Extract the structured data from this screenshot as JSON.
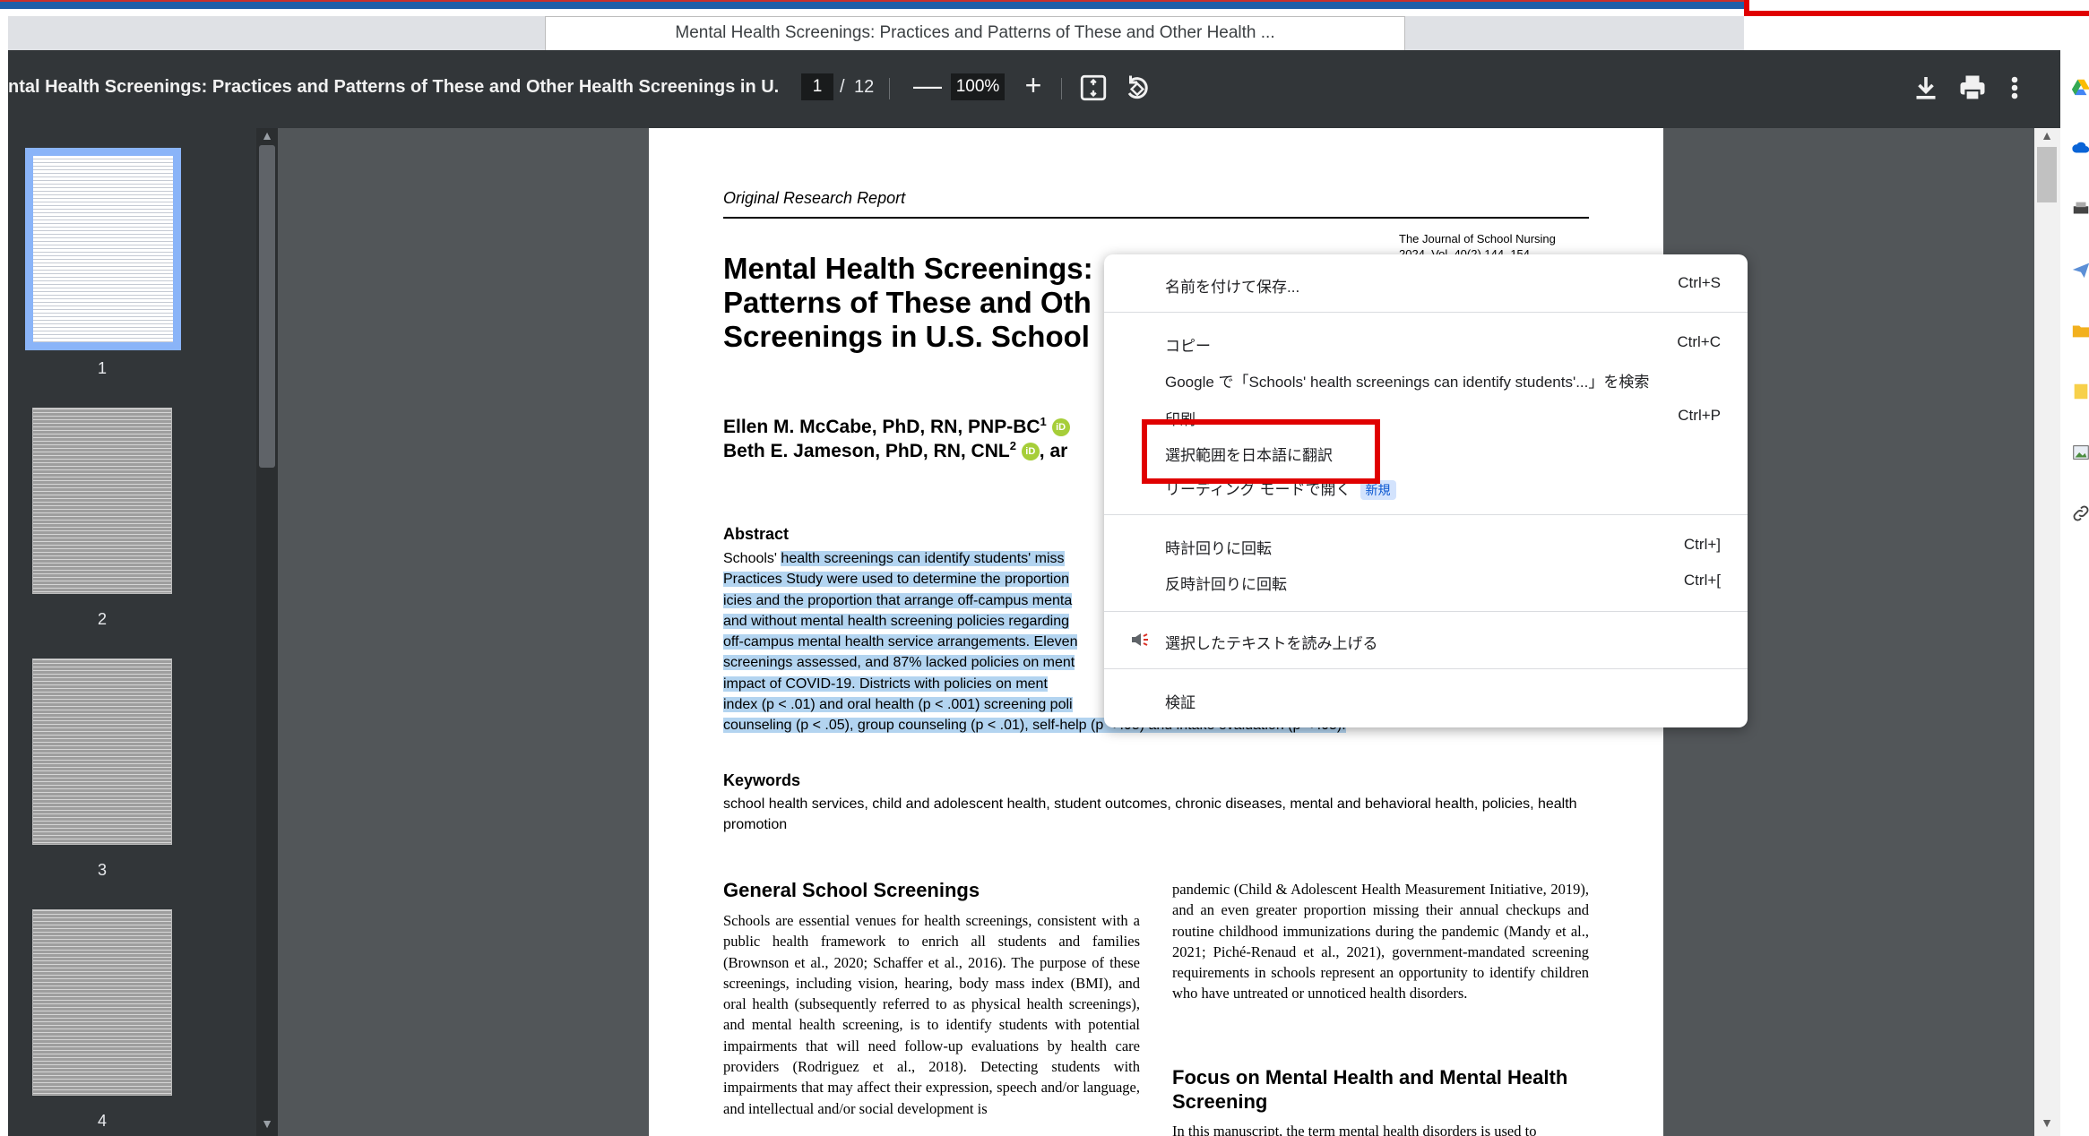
{
  "browser": {
    "tab_title": "Mental Health Screenings: Practices and Patterns of These and Other Health ..."
  },
  "toolbar": {
    "doc_title": "ntal Health Screenings: Practices and Patterns of These and Other Health Screenings in U.S. ...",
    "current_page": "1",
    "page_separator": "/",
    "total_pages": "12",
    "zoom_minus": "—",
    "zoom_level": "100%",
    "zoom_plus": "+"
  },
  "sidebar": {
    "thumbnails": [
      {
        "label": "1",
        "selected": true
      },
      {
        "label": "2",
        "selected": false
      },
      {
        "label": "3",
        "selected": false
      },
      {
        "label": "4",
        "selected": false
      }
    ]
  },
  "pdf": {
    "report_label": "Original Research Report",
    "journal_name": "The Journal of School Nursing",
    "journal_vol": "2024, Vol. 40(2) 144–154",
    "title_lines": [
      "Mental Health Screenings:",
      "Patterns of These and Oth",
      "Screenings in U.S. School"
    ],
    "authors_line1": "Ellen M. McCabe, PhD, RN, PNP-BC",
    "authors_line1_sup": "1",
    "authors_line2": "Beth E. Jameson, PhD, RN, CNL",
    "authors_line2_sup": "2",
    "authors_line2_tail": ", ar",
    "orcid_glyph": "iD",
    "abstract_heading": "Abstract",
    "abstract_lines": [
      {
        "plain": "Schools' ",
        "hl": "health screenings can identify students' miss"
      },
      {
        "plain": "",
        "hl": "Practices Study were used to determine the proportion"
      },
      {
        "plain": "",
        "hl": "icies and the proportion that arrange off-campus menta"
      },
      {
        "plain": "",
        "hl": "and without mental health screening policies regarding"
      },
      {
        "plain": "",
        "hl": "off-campus mental health service arrangements. Eleven"
      },
      {
        "plain": "",
        "hl": "screenings assessed, and 87% lacked policies on ment"
      },
      {
        "plain": "",
        "hl": "impact of COVID-19. Districts with policies on ment"
      },
      {
        "plain": "",
        "hl": "index (p < .01) and oral health (p < .001) screening poli"
      },
      {
        "plain": "",
        "hl": "counseling (p < .05), group counseling (p < .01), self-help (p < .05) and intake evaluation (p < .05)."
      }
    ],
    "keywords_heading": "Keywords",
    "keywords": "school health services, child and adolescent health, student outcomes, chronic diseases, mental and behavioral health, policies, health promotion",
    "gs_heading": "General School Screenings",
    "gs_body": "Schools are essential venues for health screenings, consistent with a public health framework to enrich all students and families (Brownson et al., 2020; Schaffer et al., 2016). The purpose of these screenings, including vision, hearing, body mass index (BMI), and oral health (subsequently referred to as physical health screenings), and mental health screening, is to identify students with potential impairments that will need follow-up evaluations by health care providers (Rodriguez et al., 2018). Detecting students with impairments that may affect their expression, speech and/or language, and intellectual and/or social development is",
    "col2_body": "pandemic (Child & Adolescent Health Measurement Initiative, 2019), and an even greater proportion missing their annual checkups and routine childhood immunizations during the pandemic (Mandy et al., 2021; Piché-Renaud et al., 2021), government-mandated screening requirements in schools represent an opportunity to identify children who have untreated or unnoticed health disorders.",
    "focus_heading": "Focus on Mental Health and Mental Health Screening",
    "focus_body": "In this manuscript, the term mental health disorders is used to"
  },
  "context_menu": {
    "items": [
      {
        "label": "名前を付けて保存...",
        "shortcut": "Ctrl+S"
      },
      {
        "label": "コピー",
        "shortcut": "Ctrl+C"
      },
      {
        "label": "Google で「Schools' health screenings can identify students'...」を検索",
        "shortcut": ""
      },
      {
        "label": "印刷",
        "shortcut": "Ctrl+P"
      },
      {
        "label": "選択範囲を日本語に翻訳",
        "shortcut": ""
      },
      {
        "label": "リーディング モードで開く",
        "shortcut": "",
        "badge": "新規"
      },
      {
        "label": "時計回りに回転",
        "shortcut": "Ctrl+]"
      },
      {
        "label": "反時計回りに回転",
        "shortcut": "Ctrl+["
      },
      {
        "label": "選択したテキストを読み上げる",
        "shortcut": ""
      },
      {
        "label": "検証",
        "shortcut": ""
      }
    ]
  },
  "colors": {
    "toolbar_bg": "#323639",
    "viewer_bg": "#525659",
    "highlight": "#b3d4f0",
    "annotation_red": "#e00000",
    "thumb_selected": "#8ab4f8"
  },
  "icons": [
    "fit-page-icon",
    "rotate-icon",
    "download-icon",
    "print-icon",
    "more-vert-icon",
    "speaker-icon",
    "google-drive-icon",
    "onedrive-icon",
    "printer-icon",
    "send-icon",
    "folder-icon",
    "note-icon",
    "image-icon",
    "link-icon"
  ]
}
